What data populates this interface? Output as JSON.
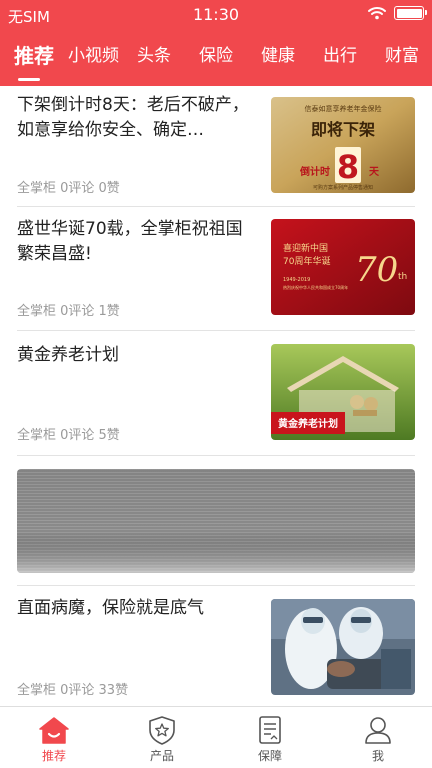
{
  "status_bar": {
    "carrier": "无SIM",
    "time": "11:30"
  },
  "tabs": [
    {
      "label": "推荐",
      "active": true
    },
    {
      "label": "小视频"
    },
    {
      "label": "头条"
    },
    {
      "label": "保险"
    },
    {
      "label": "健康"
    },
    {
      "label": "出行"
    },
    {
      "label": "财富"
    }
  ],
  "articles": [
    {
      "title": "下架倒计时8天：老后不破产，如意享给你安全、确定…",
      "meta": "全掌柜 0评论 0赞",
      "thumb": {
        "line1": "信泰如意享养老年金保险",
        "line2": "即将下架",
        "countdown_label": "倒计时",
        "number": "8",
        "unit": "天",
        "note": "可购方案系列产品停售通知"
      }
    },
    {
      "title": "盛世华诞70载，全掌柜祝祖国繁荣昌盛!",
      "meta": "全掌柜 0评论 1赞",
      "thumb": {
        "line1": "喜迎新中国",
        "line2": "70周年华诞",
        "years": "1949-2019",
        "big": "70",
        "suffix": "th",
        "note": "热烈庆祝中华人民共和国成立70周年"
      }
    },
    {
      "title": "黄金养老计划",
      "meta": "全掌柜 0评论 5赞",
      "thumb": {
        "label": "黄金养老计划"
      }
    },
    {
      "title": "直面病魔，保险就是底气",
      "meta": "全掌柜 0评论 33赞"
    }
  ],
  "bottom_nav": [
    {
      "label": "推荐",
      "icon": "home-icon",
      "active": true
    },
    {
      "label": "产品",
      "icon": "shield-star-icon"
    },
    {
      "label": "保障",
      "icon": "document-icon"
    },
    {
      "label": "我",
      "icon": "user-icon"
    }
  ],
  "colors": {
    "brand": "#f1484d",
    "meta_text": "#9a9a9a"
  }
}
